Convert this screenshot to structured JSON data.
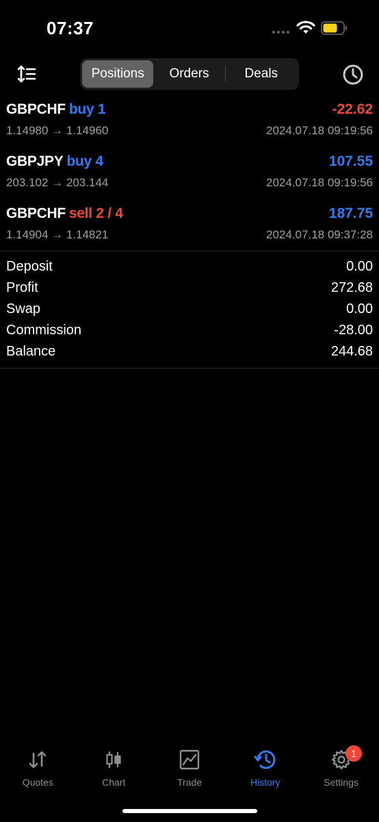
{
  "status_bar": {
    "time": "07:37"
  },
  "toolbar": {
    "tabs": [
      {
        "label": "Positions",
        "active": true
      },
      {
        "label": "Orders",
        "active": false
      },
      {
        "label": "Deals",
        "active": false
      }
    ],
    "left_icon": "sort-icon",
    "right_icon": "history-clock-icon"
  },
  "positions": [
    {
      "symbol": "GBPCHF",
      "side": "buy 1",
      "side_type": "buy",
      "prices": "1.14980 → 1.14960",
      "profit": "-22.62",
      "profit_sign": "neg",
      "time": "2024.07.18 09:19:56"
    },
    {
      "symbol": "GBPJPY",
      "side": "buy 4",
      "side_type": "buy",
      "prices": "203.102 → 203.144",
      "profit": "107.55",
      "profit_sign": "pos",
      "time": "2024.07.18 09:19:56"
    },
    {
      "symbol": "GBPCHF",
      "side": "sell 2 / 4",
      "side_type": "sell",
      "prices": "1.14904 → 1.14821",
      "profit": "187.75",
      "profit_sign": "pos",
      "time": "2024.07.18 09:37:28"
    }
  ],
  "summary": {
    "deposit_label": "Deposit",
    "deposit_value": "0.00",
    "profit_label": "Profit",
    "profit_value": "272.68",
    "swap_label": "Swap",
    "swap_value": "0.00",
    "commission_label": "Commission",
    "commission_value": "-28.00",
    "balance_label": "Balance",
    "balance_value": "244.68"
  },
  "tabbar": {
    "items": [
      {
        "label": "Quotes",
        "icon": "quotes-icon"
      },
      {
        "label": "Chart",
        "icon": "chart-icon"
      },
      {
        "label": "Trade",
        "icon": "trade-icon"
      },
      {
        "label": "History",
        "icon": "history-icon",
        "active": true
      },
      {
        "label": "Settings",
        "icon": "settings-icon",
        "badge": "1"
      }
    ]
  },
  "colors": {
    "accent": "#2f7cf6",
    "negative": "#f0453a",
    "background": "#000000",
    "muted": "#a1a1a6"
  }
}
